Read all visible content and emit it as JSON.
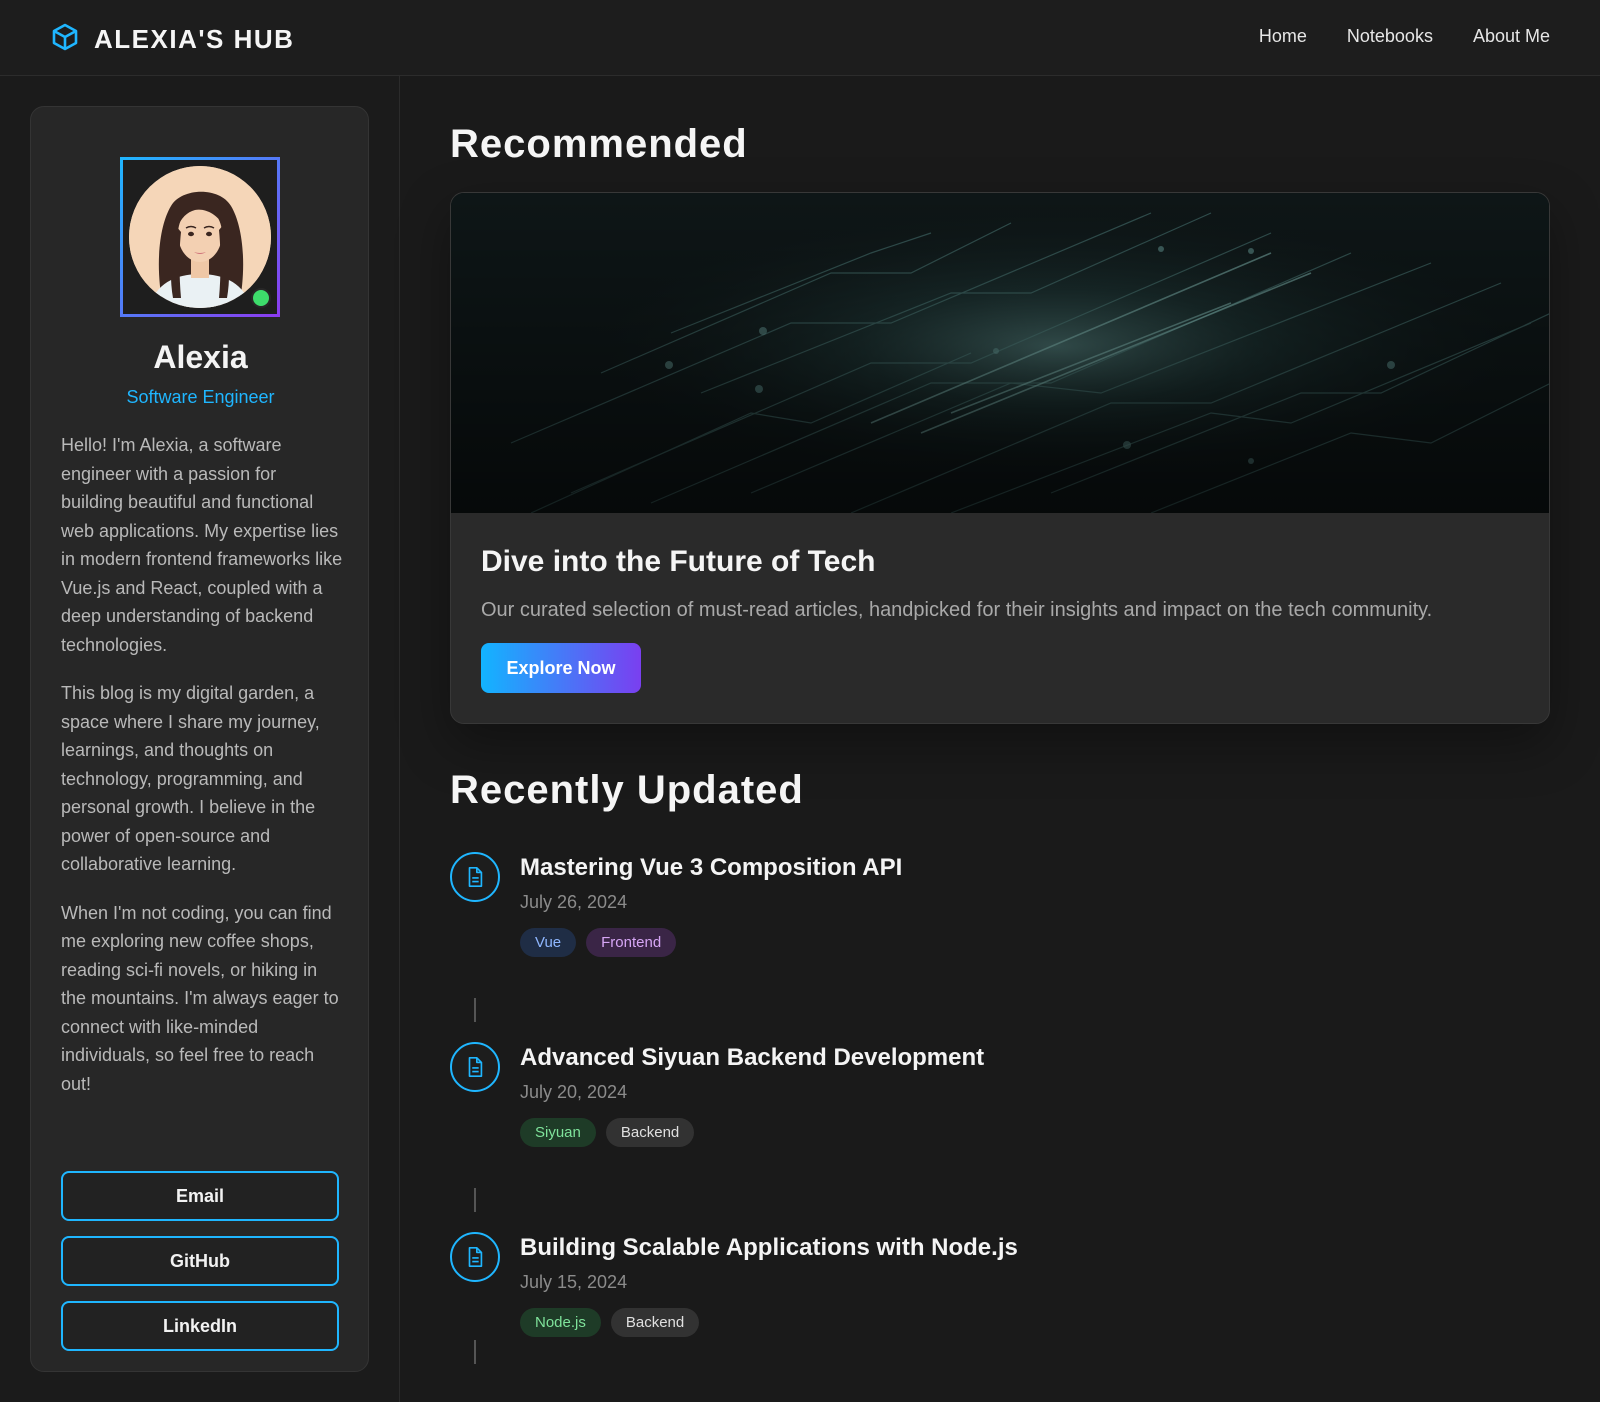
{
  "header": {
    "brand": "ALEXIA'S HUB",
    "brand_icon": "cube-icon",
    "nav": [
      "Home",
      "Notebooks",
      "About Me"
    ]
  },
  "profile": {
    "name": "Alexia",
    "role": "Software Engineer",
    "online": true,
    "bio": [
      "Hello! I'm Alexia, a software engineer with a passion for building beautiful and functional web applications. My expertise lies in modern frontend frameworks like Vue.js and React, coupled with a deep understanding of backend technologies.",
      "This blog is my digital garden, a space where I share my journey, learnings, and thoughts on technology, programming, and personal growth. I believe in the power of open-source and collaborative learning.",
      "When I'm not coding, you can find me exploring new coffee shops, reading sci-fi novels, or hiking in the mountains. I'm always eager to connect with like-minded individuals, so feel free to reach out!"
    ],
    "links": [
      "Email",
      "GitHub",
      "LinkedIn"
    ]
  },
  "recommended": {
    "section_title": "Recommended",
    "title": "Dive into the Future of Tech",
    "description": "Our curated selection of must-read articles, handpicked for their insights and impact on the tech community.",
    "cta": "Explore Now"
  },
  "recent": {
    "section_title": "Recently Updated",
    "items": [
      {
        "title": "Mastering Vue 3 Composition API",
        "date": "July 26, 2024",
        "tags": [
          {
            "label": "Vue",
            "bg": "#1f2d45",
            "fg": "#8fb7ff"
          },
          {
            "label": "Frontend",
            "bg": "#3a2546",
            "fg": "#d6a6f5"
          }
        ]
      },
      {
        "title": "Advanced Siyuan Backend Development",
        "date": "July 20, 2024",
        "tags": [
          {
            "label": "Siyuan",
            "bg": "#1e3b27",
            "fg": "#7fe39b"
          },
          {
            "label": "Backend",
            "bg": "#323232",
            "fg": "#e0e0e0"
          }
        ]
      },
      {
        "title": "Building Scalable Applications with Node.js",
        "date": "July 15, 2024",
        "tags": [
          {
            "label": "Node.js",
            "bg": "#1e3b27",
            "fg": "#7fe39b"
          },
          {
            "label": "Backend",
            "bg": "#323232",
            "fg": "#e0e0e0"
          }
        ]
      }
    ]
  },
  "colors": {
    "accent": "#1fb6ff",
    "accent2": "#7a3ff0",
    "online": "#3ddc6b"
  }
}
